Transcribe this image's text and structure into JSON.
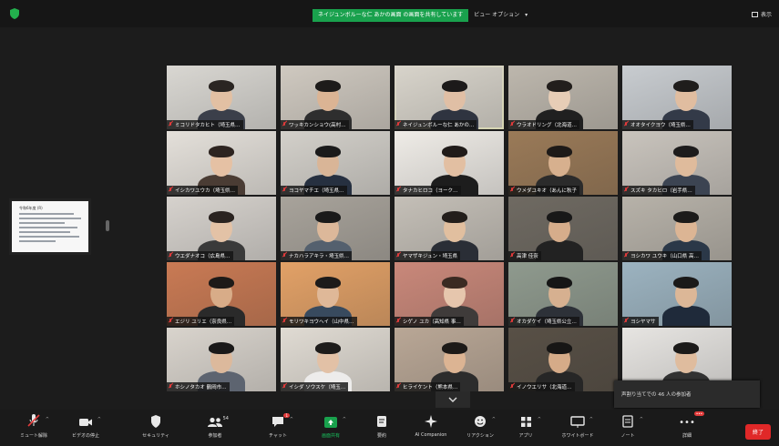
{
  "top_bar": {
    "share_status": "ネイジュンボルーな仁 あかの画面 の画面を共有しています",
    "view_option": "ビュー オプション",
    "view_label": "表示"
  },
  "shared_document": {
    "title": "令和6年度 (R)"
  },
  "participants": [
    {
      "name": "ミコリドタカヒト（埼玉県…"
    },
    {
      "name": "ワッキカンショウ(高村…"
    },
    {
      "name": "ネイジュンボルーな仁 あかの…"
    },
    {
      "name": "ウラオドリング（北海道…"
    },
    {
      "name": "オオタイクヨウ（埼玉県…"
    },
    {
      "name": "イシカワユウカ（埼玉県…"
    },
    {
      "name": "ヨコヤマチエ（埼玉県…"
    },
    {
      "name": "タナカヒロコ（ヨーク…"
    },
    {
      "name": "ウメダユキオ（あんに秋子"
    },
    {
      "name": "スズキ タカヒロ（岩手県…"
    },
    {
      "name": "ウエダナオコ（広島県…"
    },
    {
      "name": "ナカハラアキラ・埼玉県…"
    },
    {
      "name": "ヤマザキジュン・埼玉県"
    },
    {
      "name": "高津 佳奈"
    },
    {
      "name": "ヨシカワ ユウキ（山口県 高…"
    },
    {
      "name": "エジリ ユリエ（奈良県…"
    },
    {
      "name": "モリワキヨウヘイ（山中県…"
    },
    {
      "name": "シゲノ ユカ（高知県 事…"
    },
    {
      "name": "オカダケイ（埼玉県公立…"
    },
    {
      "name": "ヨシヤマサ"
    },
    {
      "name": "ホシノタカオ 鶴岡市…"
    },
    {
      "name": "イシダ ソウスケ（埼玉…"
    },
    {
      "name": "ヒライケント（熊本県…"
    },
    {
      "name": "イノウエリサ（北海道…"
    },
    {
      "name": ""
    }
  ],
  "toast": {
    "text": "声割り当てでの 46 人の参加者"
  },
  "toolbar": {
    "unmute": "ミュート解除",
    "stop_video": "ビデオの停止",
    "security": "セキュリティ",
    "participants": "参加者",
    "participant_count": "54",
    "chat": "チャット",
    "chat_badge": "1",
    "share": "画面共有",
    "summary": "要約",
    "ai_companion": "AI Companion",
    "reactions": "リアクション",
    "apps": "アプリ",
    "whiteboard": "ホワイトボード",
    "notes": "ノート",
    "more": "詳細",
    "more_badge": "•••",
    "end": "終了"
  },
  "colors": {
    "share_green": "#19a14d",
    "speaker_outline": "#c9d64a",
    "end_red": "#e02828"
  }
}
